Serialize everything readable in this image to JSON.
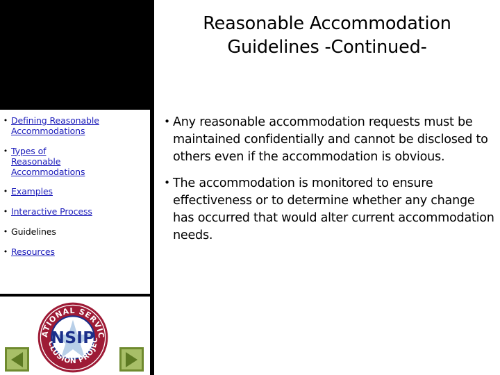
{
  "slide": {
    "title": "Reasonable Accommodation Guidelines -Continued-",
    "title_line1": "Reasonable Accommodation",
    "title_line2": "Guidelines -Continued-"
  },
  "sidebar": {
    "nav_items": [
      {
        "label": "Defining Reasonable Accommodations",
        "bullet": "•",
        "is_link": true,
        "current": false
      },
      {
        "label": "Types of Reasonable Accommodations",
        "bullet": "•",
        "is_link": true,
        "current": false
      },
      {
        "label": "Examples",
        "bullet": "•",
        "is_link": true,
        "current": false
      },
      {
        "label": "Interactive Process",
        "bullet": "•",
        "is_link": true,
        "current": false
      },
      {
        "label": "Guidelines",
        "bullet": "•",
        "is_link": false,
        "current": true
      },
      {
        "label": "Resources",
        "bullet": "•",
        "is_link": true,
        "current": false
      }
    ],
    "logo": {
      "name": "nsip-logo",
      "center_text": "NSIP",
      "arc_top_text": "NATIONAL SERVICE",
      "arc_bottom_text": "INCLUSION PROJECT",
      "ring_color": "#9e1b36",
      "center_bg_color": "#ffffff",
      "star_color": "#b8cfe8",
      "text_color": "#1b2f8a"
    },
    "controls": {
      "prev_label": "Previous slide",
      "next_label": "Next slide",
      "button_fill": "#a8bf68",
      "button_border": "#6f8a2e",
      "arrow_color": "#5d7a23"
    }
  },
  "main": {
    "bullets": [
      {
        "bullet": "•",
        "text": "Any reasonable accommodation requests must be maintained confidentially and cannot be disclosed to others even if the accommodation is obvious."
      },
      {
        "bullet": "•",
        "text": "The accommodation is monitored to ensure effectiveness or to determine whether any change has occurred that would alter current accommodation needs."
      }
    ]
  },
  "colors": {
    "link": "#1a1aba",
    "text": "#000000",
    "background": "#ffffff",
    "header_block": "#000000"
  }
}
